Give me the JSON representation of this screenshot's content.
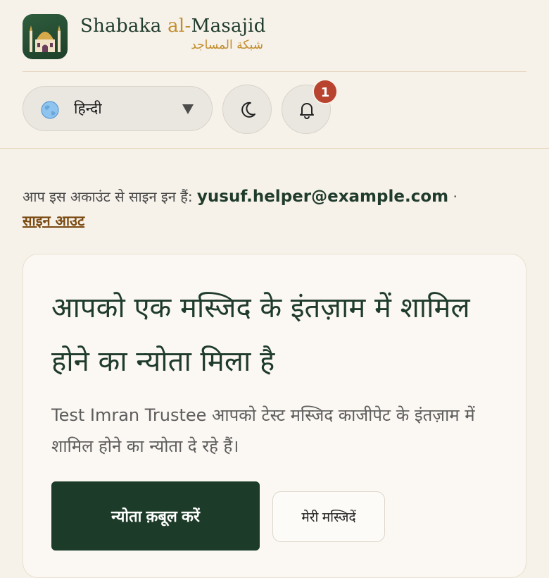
{
  "brand": {
    "name_en_prefix": "Shabaka ",
    "name_en_al": "al-",
    "name_en_suffix": "Masajid",
    "name_ar": "شبكة المساجد"
  },
  "controls": {
    "language_selected": "हिन्दी",
    "notification_count": "1"
  },
  "signed_in": {
    "prefix": "आप इस अकाउंट से साइन इन हैं: ",
    "email": "yusuf.helper@example.com",
    "separator": " ·",
    "signout_label": "साइन आउट"
  },
  "invite": {
    "title": "आपको एक मस्जिद के इंतज़ाम में शामिल होने का न्योता मिला है",
    "description": "Test Imran Trustee आपको टेस्ट मस्जिद काजीपेट के इंतज़ाम में शामिल होने का न्योता दे रहे हैं।",
    "accept_label": "न्योता क़बूल करें",
    "my_mosques_label": "मेरी मस्जिदें"
  },
  "colors": {
    "background": "#f6f1e9",
    "primary": "#1c3b28",
    "accent": "#c28d2c",
    "badge": "#b8432f"
  },
  "icons": {
    "logo": "mosque-icon",
    "language": "globe-icon",
    "theme": "moon-icon",
    "notifications": "bell-icon"
  }
}
